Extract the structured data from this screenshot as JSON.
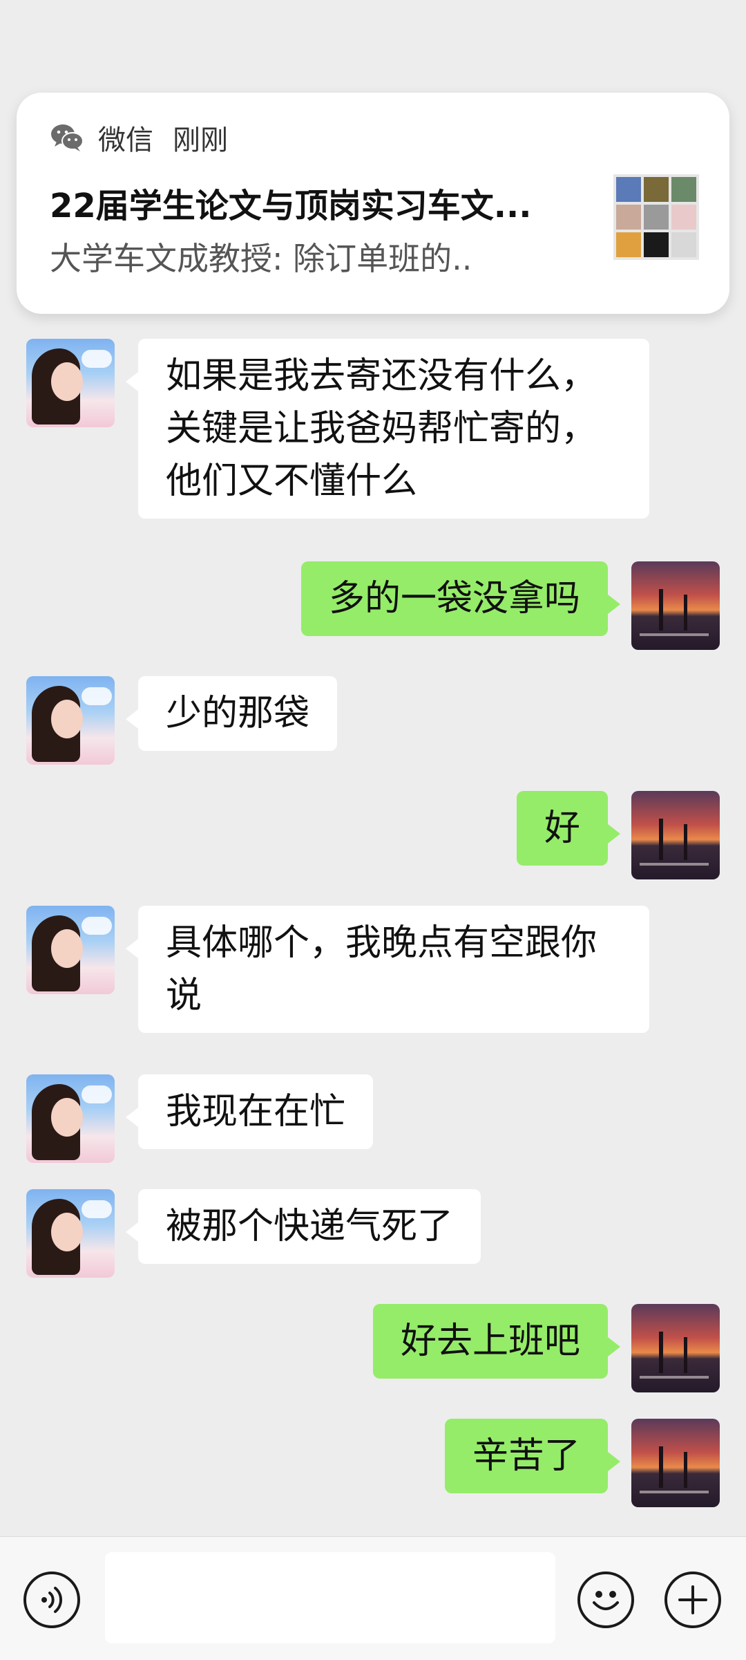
{
  "notification": {
    "app_name": "微信",
    "time": "刚刚",
    "title": "22届学生论文与顶岗实习车文...",
    "body": "大学车文成教授: 除订单班的.."
  },
  "messages": [
    {
      "side": "left",
      "text": "如果是我去寄还没有什么，关键是让我爸妈帮忙寄的，他们又不懂什么"
    },
    {
      "side": "right",
      "text": "多的一袋没拿吗"
    },
    {
      "side": "left",
      "text": "少的那袋"
    },
    {
      "side": "right",
      "text": "好"
    },
    {
      "side": "left",
      "text": "具体哪个，我晚点有空跟你说"
    },
    {
      "side": "left",
      "text": "我现在在忙"
    },
    {
      "side": "left",
      "text": "被那个快递气死了"
    },
    {
      "side": "right",
      "text": "好去上班吧"
    },
    {
      "side": "right",
      "text": "辛苦了"
    }
  ],
  "input": {
    "value": "",
    "voice_icon": "voice-icon",
    "emoji_icon": "emoji-icon",
    "plus_icon": "plus-icon"
  },
  "colors": {
    "background": "#ededed",
    "bubble_self": "#95ec69",
    "bubble_other": "#ffffff"
  }
}
